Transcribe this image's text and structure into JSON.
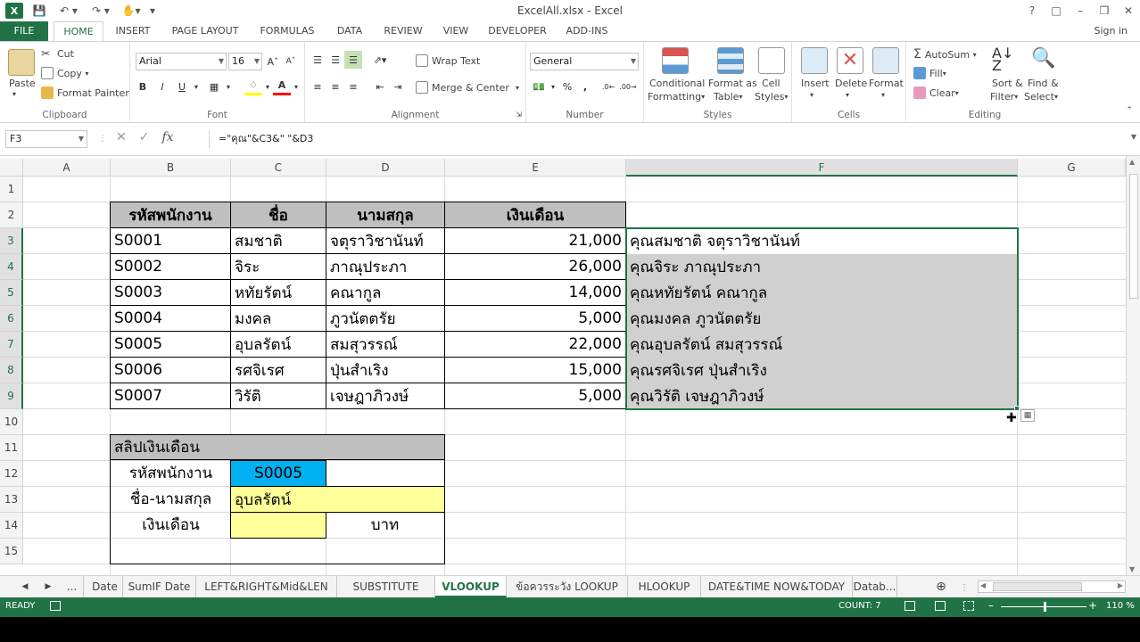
{
  "titlebar": {
    "title": "ExcelAll.xlsx - Excel",
    "help": "?",
    "restore": "□",
    "minimize": "–",
    "maximize": "❐",
    "close": "✕"
  },
  "ribbon_tabs": [
    "FILE",
    "HOME",
    "INSERT",
    "PAGE LAYOUT",
    "FORMULAS",
    "DATA",
    "REVIEW",
    "VIEW",
    "DEVELOPER",
    "ADD-INS"
  ],
  "signin": "Sign in",
  "clipboard": {
    "paste": "Paste",
    "cut": "Cut",
    "copy": "Copy",
    "format_painter": "Format Painter",
    "label": "Clipboard"
  },
  "font": {
    "name": "Arial",
    "size": "16",
    "label": "Font",
    "bold": "B",
    "italic": "I",
    "underline": "U"
  },
  "alignment": {
    "wrap": "Wrap Text",
    "merge": "Merge & Center",
    "label": "Alignment"
  },
  "number": {
    "format": "General",
    "percent": "%",
    "comma": ",",
    "label": "Number"
  },
  "styles": {
    "conditional": [
      "Conditional",
      "Formatting"
    ],
    "format_table": [
      "Format as",
      "Table"
    ],
    "cell_styles": [
      "Cell",
      "Styles"
    ],
    "label": "Styles"
  },
  "cells": {
    "insert": "Insert",
    "delete": "Delete",
    "format": "Format",
    "label": "Cells"
  },
  "editing": {
    "autosum": "AutoSum",
    "fill": "Fill",
    "clear": "Clear",
    "sort": [
      "Sort &",
      "Filter"
    ],
    "find": [
      "Find &",
      "Select"
    ],
    "label": "Editing"
  },
  "formula_bar": {
    "name_box": "F3",
    "formula": "=\"คุณ\"&C3&\" \"&D3"
  },
  "columns": [
    "A",
    "B",
    "C",
    "D",
    "E",
    "F",
    "G"
  ],
  "rows": [
    "1",
    "2",
    "3",
    "4",
    "5",
    "6",
    "7",
    "8",
    "9",
    "10",
    "11",
    "12",
    "13",
    "14",
    "15"
  ],
  "table": {
    "headers": [
      "รหัสพนักงาน",
      "ชื่อ",
      "นามสกุล",
      "เงินเดือน"
    ],
    "rows": [
      [
        "S0001",
        "สมชาติ",
        "จตุราวิชานันท์",
        "21,000",
        "คุณสมชาติ จตุราวิชานันท์"
      ],
      [
        "S0002",
        "จิระ",
        "ภาณุประภา",
        "26,000",
        "คุณจิระ ภาณุประภา"
      ],
      [
        "S0003",
        "หทัยรัตน์",
        "คณากูล",
        "14,000",
        "คุณหทัยรัตน์ คณากูล"
      ],
      [
        "S0004",
        "มงคล",
        "ภูวนัตตรัย",
        "5,000",
        "คุณมงคล ภูวนัตตรัย"
      ],
      [
        "S0005",
        "อุบลรัตน์",
        "สมสุวรรณ์",
        "22,000",
        "คุณอุบลรัตน์ สมสุวรรณ์"
      ],
      [
        "S0006",
        "รศจิเรศ",
        "ปุ่นสำเริง",
        "15,000",
        "คุณรศจิเรศ ปุ่นสำเริง"
      ],
      [
        "S0007",
        "วิรัติ",
        "เจษฎาภิวงษ์",
        "5,000",
        "คุณวิรัติ เจษฎาภิวงษ์"
      ]
    ]
  },
  "slip": {
    "title": "สลิปเงินเดือน",
    "id_label": "รหัสพนักงาน",
    "id_value": "S0005",
    "name_label": "ชื่อ-นามสกุล",
    "name_value": "อุบลรัตน์",
    "salary_label": "เงินเดือน",
    "salary_value": "",
    "unit": "บาท"
  },
  "sheet_tabs": {
    "ellipsis": "...",
    "items": [
      "Date",
      "SumIF Date",
      "LEFT&RIGHT&Mid&LEN",
      "SUBSTITUTE",
      "VLOOKUP",
      "ข้อควรระวัง LOOKUP",
      "HLOOKUP",
      "DATE&TIME  NOW&TODAY",
      "Datab..."
    ],
    "active": "VLOOKUP"
  },
  "statusbar": {
    "ready": "READY",
    "count": "COUNT: 7",
    "zoom": "110 %"
  },
  "colors": {
    "excel_green": "#217346",
    "header_gray": "#bfbfbf",
    "cyan": "#00b0f0",
    "yellow": "#ffff99"
  }
}
